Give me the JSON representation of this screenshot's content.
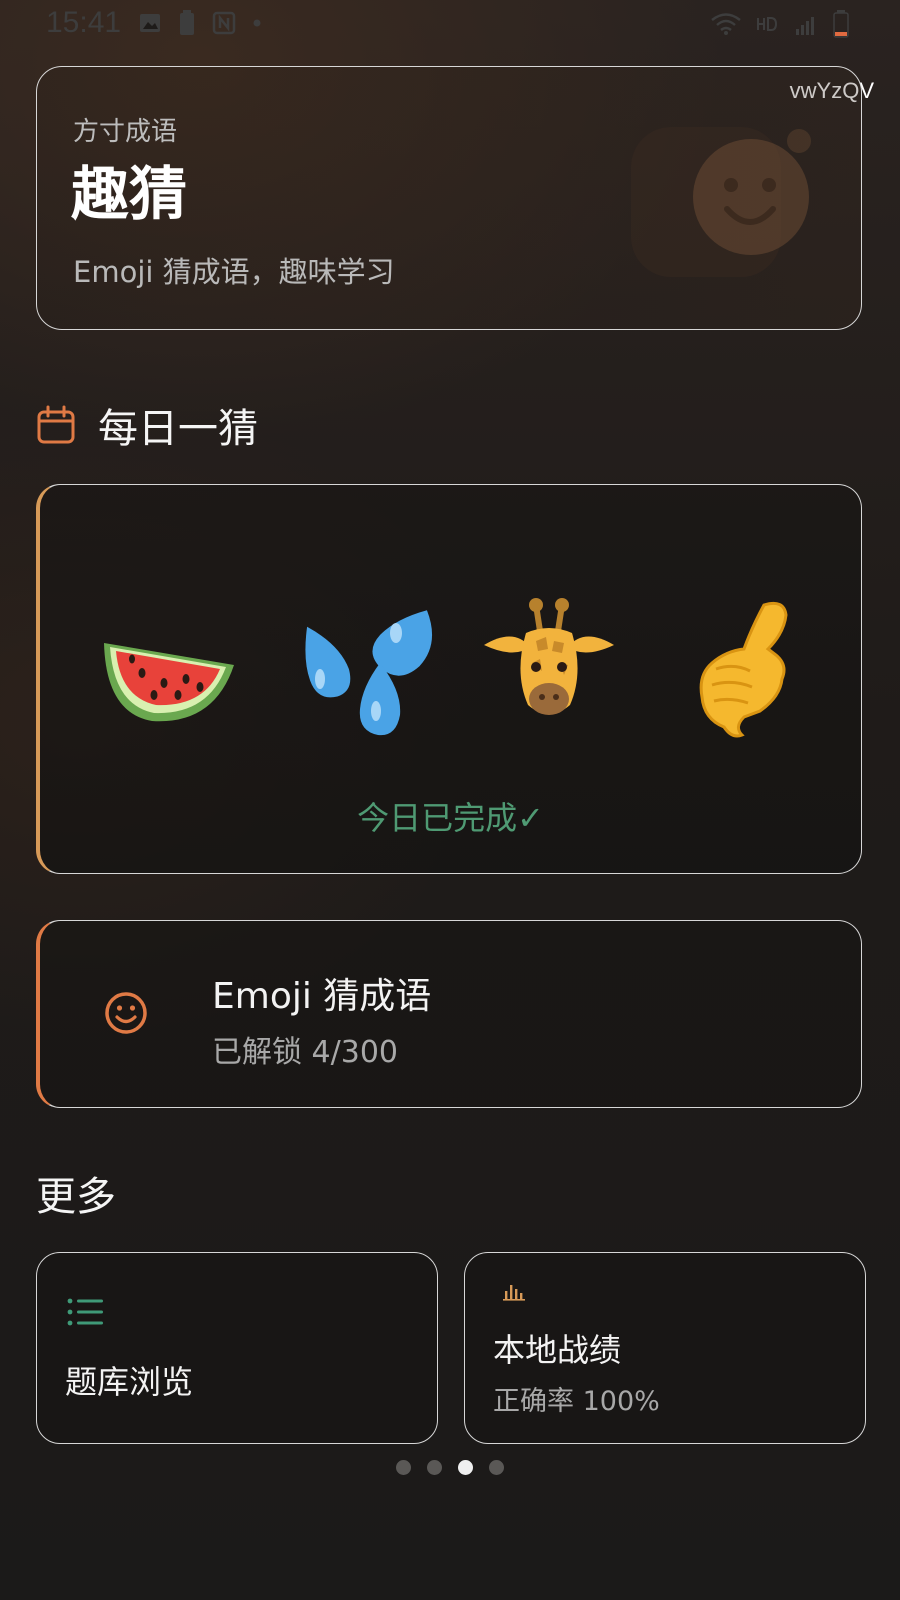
{
  "status_bar": {
    "time": "15:41",
    "left_icons": [
      "image-icon",
      "battery-saver-icon",
      "nfc-icon",
      "dot-icon"
    ],
    "right_icons": [
      "wifi-icon",
      "hd-icon",
      "signal-4g-icon",
      "battery-low-icon"
    ],
    "watermark": "vwYzQV"
  },
  "hero": {
    "subtitle": "方寸成语",
    "title": "趣猜",
    "description": "Emoji 猜成语，趣味学习",
    "deco_icon": "smiley-icon"
  },
  "daily": {
    "section_title": "每日一猜",
    "section_icon": "calendar-icon",
    "emojis": [
      "watermelon",
      "sweat-droplets",
      "giraffe",
      "call-me-hand"
    ],
    "status": "今日已完成✓"
  },
  "game": {
    "icon": "smiley-icon",
    "title": "Emoji 猜成语",
    "progress_text": "已解锁 4/300",
    "unlocked": 4,
    "total": 300
  },
  "more": {
    "title": "更多",
    "cards": [
      {
        "icon": "list-icon",
        "label": "题库浏览"
      },
      {
        "icon": "bar-chart-icon",
        "label": "本地战绩",
        "sub": "正确率 100%"
      }
    ]
  },
  "pagination": {
    "count": 4,
    "active_index": 2
  },
  "colors": {
    "accent_orange": "#e07a45",
    "accent_gold": "#d79a58",
    "success_green": "#4f9a73",
    "list_icon_green": "#3f9a78"
  }
}
